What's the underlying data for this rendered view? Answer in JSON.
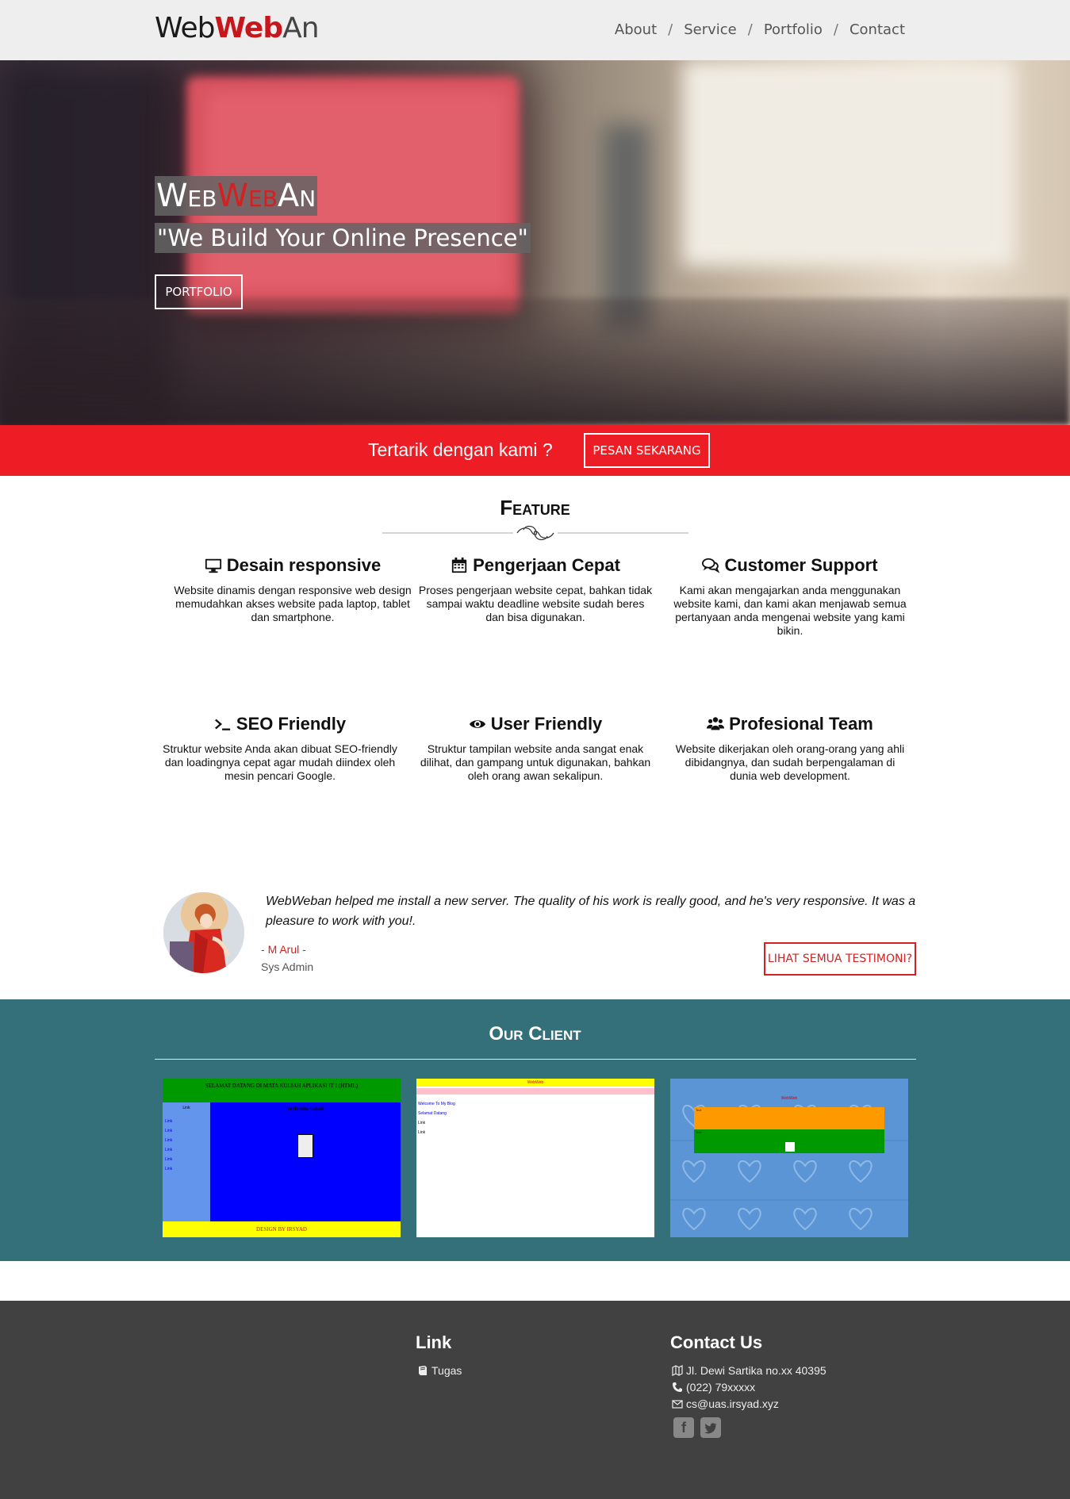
{
  "navbar": {
    "brand": {
      "part1": "Web",
      "part2": "Web",
      "part3": "An"
    },
    "links": [
      "About",
      "Service",
      "Portfolio",
      "Contact"
    ],
    "separator": "/"
  },
  "hero": {
    "title": {
      "part1": "Web",
      "part2": "Web",
      "part3": "An"
    },
    "subtitle": "\"We Build Your Online Presence\"",
    "button": "PORTFOLIO"
  },
  "cta": {
    "text": "Tertarik dengan kami ?",
    "button": "PESAN SEKARANG"
  },
  "feature": {
    "title": "Feature",
    "items": [
      {
        "icon": "monitor-icon",
        "title": "Desain responsive",
        "text": "Website dinamis dengan responsive web design memudahkan akses website pada laptop, tablet dan smartphone."
      },
      {
        "icon": "calendar-icon",
        "title": "Pengerjaan Cepat",
        "text": "Proses pengerjaan website cepat, bahkan tidak sampai waktu deadline website sudah beres dan bisa digunakan."
      },
      {
        "icon": "chat-icon",
        "title": "Customer Support",
        "text": "Kami akan mengajarkan anda menggunakan website kami, dan kami akan menjawab semua pertanyaan anda mengenai website yang kami bikin."
      },
      {
        "icon": "terminal-icon",
        "title": "SEO Friendly",
        "text": "Struktur website Anda akan dibuat SEO-friendly dan loadingnya cepat agar mudah diindex oleh mesin pencari Google."
      },
      {
        "icon": "eye-icon",
        "title": "User Friendly",
        "text": "Struktur tampilan website anda sangat enak dilihat, dan gampang untuk digunakan, bahkan oleh orang awan sekalipun."
      },
      {
        "icon": "users-icon",
        "title": "Profesional Team",
        "text": "Website dikerjakan oleh orang-orang yang ahli dibidangnya, dan sudah berpengalaman di dunia web development."
      }
    ]
  },
  "testimonial": {
    "quote": "WebWeban helped me install a new server. The quality of his work is really good, and he's very responsive. It was a pleasure to work with you!.",
    "author_prefix": "- ",
    "author_name": "M Arul",
    "author_suffix": " -",
    "role": "Sys Admin",
    "button": "LIHAT SEMUA TESTIMONI?"
  },
  "client": {
    "title": "Our Client",
    "shots": [
      {
        "header": "SELAMAT DATANG DI MATA KULIAH APLIKASI IT I (HTML)",
        "subheader": "Welcome Guest",
        "footer": "DESIGN BY IRSYAD",
        "sidebar_title": "Link",
        "sidebar_links": [
          "Link",
          "Link",
          "Link",
          "Link",
          "Link",
          "Link"
        ]
      },
      {
        "header": "WebWeb",
        "lines": [
          "Welcome To My Blog",
          "Selamat Datang",
          "Link",
          "Link"
        ]
      },
      {
        "header": "WebWeb",
        "lines": [
          "Text",
          "Text"
        ]
      }
    ]
  },
  "footer": {
    "link_title": "Link",
    "link_item": "Tugas",
    "contact_title": "Contact Us",
    "address": "Jl. Dewi Sartika no.xx 40395",
    "phone": "(022) 79xxxxx",
    "email": "cs@uas.irsyad.xyz",
    "social": [
      "facebook-icon",
      "twitter-icon"
    ]
  },
  "colors": {
    "accent": "#ee1c24",
    "brand_red": "#c8161d",
    "client_bg": "#337079",
    "footer_bg": "#414141",
    "navbar_bg": "#eeeeee"
  }
}
